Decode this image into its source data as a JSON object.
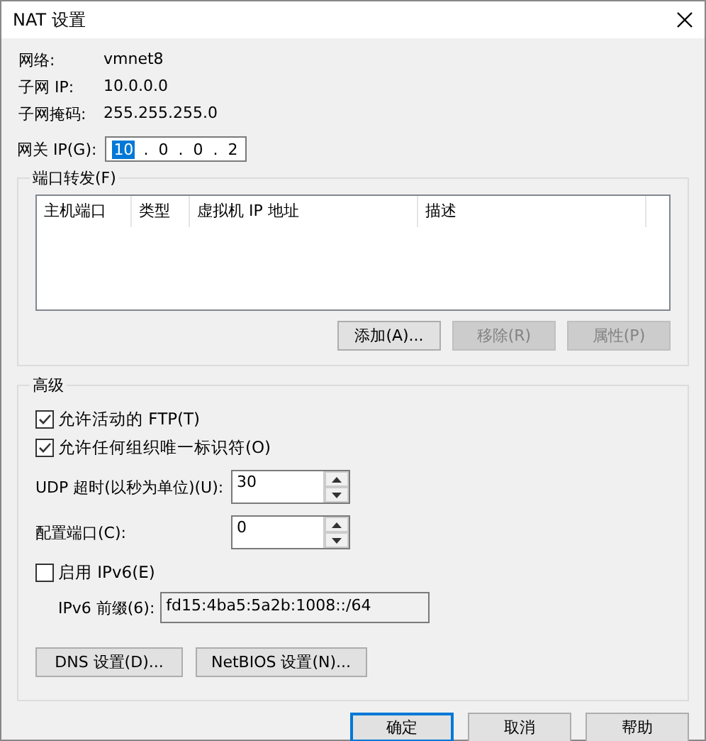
{
  "window": {
    "title": "NAT 设置"
  },
  "info": [
    {
      "label": "网络:",
      "value": "vmnet8"
    },
    {
      "label": "子网 IP:",
      "value": "10.0.0.0"
    },
    {
      "label": "子网掩码:",
      "value": "255.255.255.0"
    }
  ],
  "gateway": {
    "label": "网关 IP(G):",
    "separator": ".",
    "octets": [
      {
        "value": "10",
        "selected": true
      },
      {
        "value": "0",
        "selected": false
      },
      {
        "value": "0",
        "selected": false
      },
      {
        "value": "2",
        "selected": false
      }
    ]
  },
  "port_forwarding": {
    "title": "端口转发(F)",
    "columns": [
      "主机端口",
      "类型",
      "虚拟机 IP 地址",
      "描述"
    ],
    "buttons": [
      {
        "label": "添加(A)...",
        "disabled": false
      },
      {
        "label": "移除(R)",
        "disabled": true
      },
      {
        "label": "属性(P)",
        "disabled": true
      }
    ]
  },
  "advanced": {
    "title": "高级",
    "checks": [
      {
        "label": "允许活动的 FTP(T)",
        "checked": true
      },
      {
        "label": "允许任何组织唯一标识符(O)",
        "checked": true
      }
    ],
    "spinners": [
      {
        "label": "UDP 超时(以秒为单位)(U):",
        "value": "30"
      },
      {
        "label": "配置端口(C):",
        "value": "0"
      }
    ],
    "ipv6": {
      "label": "启用 IPv6(E)",
      "checked": false
    },
    "prefix": {
      "label": "IPv6 前缀(6):",
      "value": "fd15:4ba5:5a2b:1008::/64"
    },
    "buttons": [
      "DNS 设置(D)...",
      "NetBIOS 设置(N)..."
    ]
  },
  "buttons": [
    {
      "label": "确定",
      "selected": true
    },
    {
      "label": "取消",
      "selected": false
    },
    {
      "label": "帮助",
      "selected": false
    }
  ]
}
